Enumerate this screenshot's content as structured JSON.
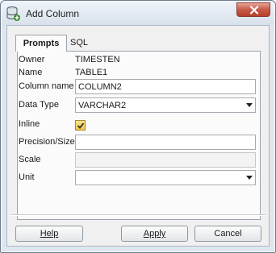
{
  "window": {
    "title": "Add Column",
    "app_icon": "database-icon",
    "close_icon": "close-icon"
  },
  "tabs": [
    {
      "label": "Prompts",
      "active": true
    },
    {
      "label": "SQL",
      "active": false
    }
  ],
  "form": {
    "owner_label": "Owner",
    "owner_value": "TIMESTEN",
    "name_label": "Name",
    "name_value": "TABLE1",
    "column_name_label": "Column name",
    "column_name_value": "COLUMN2",
    "data_type_label": "Data Type",
    "data_type_value": "VARCHAR2",
    "inline_label": "Inline",
    "inline_checked": true,
    "precision_label": "Precision/Size",
    "precision_value": "",
    "scale_label": "Scale",
    "scale_value": "",
    "unit_label": "Unit",
    "unit_value": ""
  },
  "buttons": {
    "help_label": "Help",
    "apply_label": "Apply",
    "cancel_label": "Cancel"
  },
  "colors": {
    "accent_checkbox": "#f2c24a",
    "close_button": "#c75a48"
  }
}
